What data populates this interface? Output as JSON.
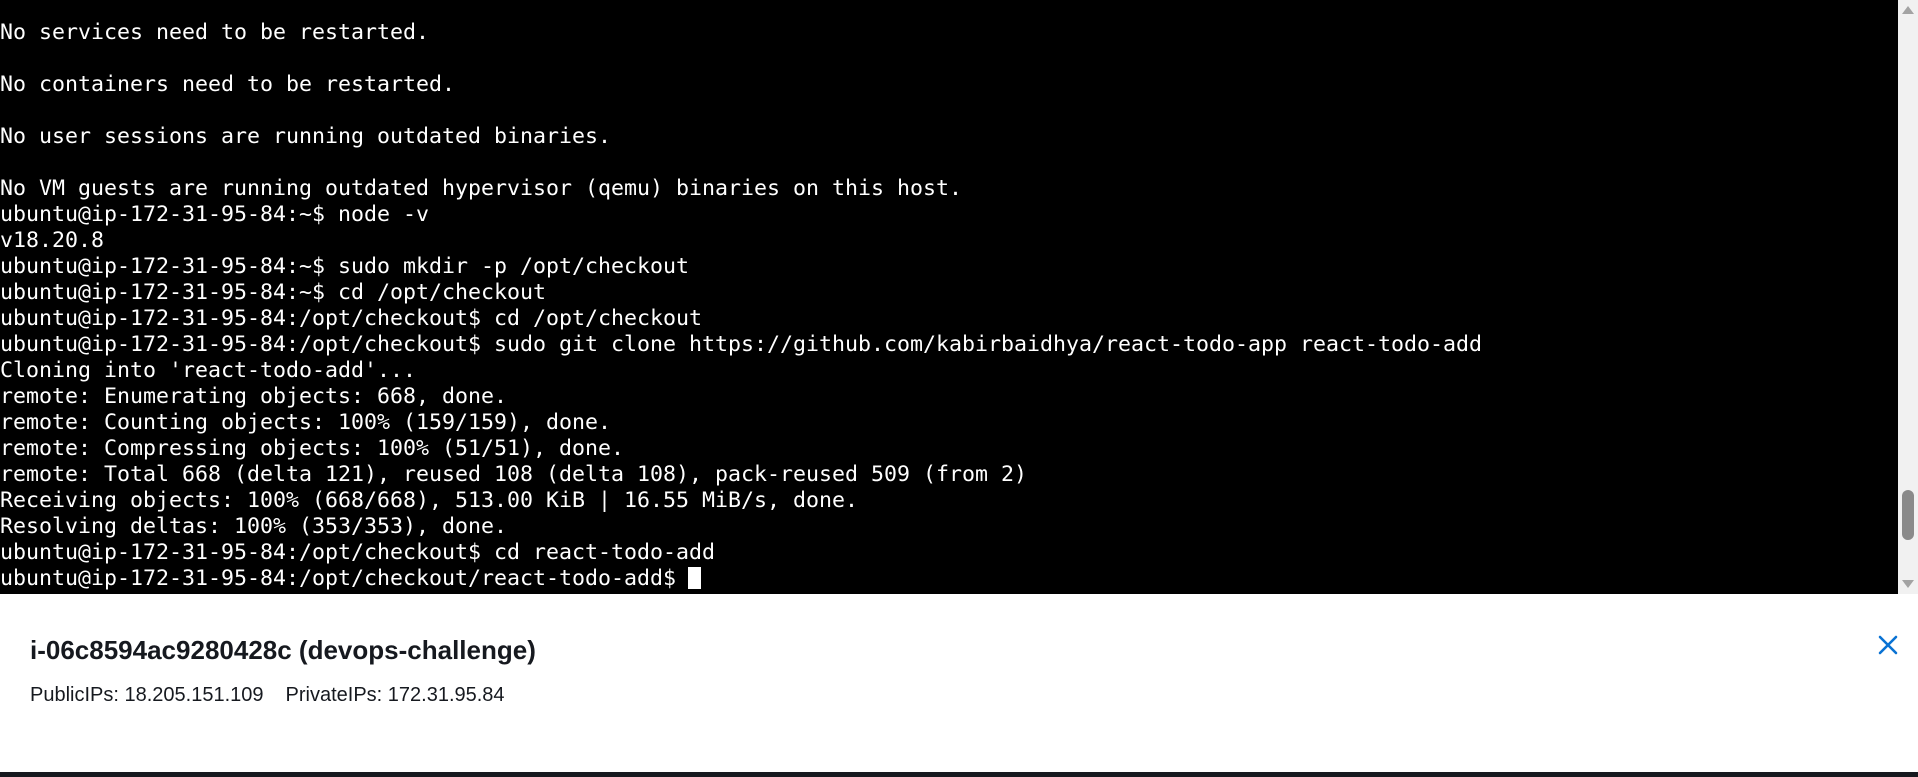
{
  "terminal": {
    "lines": [
      "No services need to be restarted.",
      "",
      "No containers need to be restarted.",
      "",
      "No user sessions are running outdated binaries.",
      "",
      "No VM guests are running outdated hypervisor (qemu) binaries on this host.",
      "ubuntu@ip-172-31-95-84:~$ node -v",
      "v18.20.8",
      "ubuntu@ip-172-31-95-84:~$ sudo mkdir -p /opt/checkout",
      "ubuntu@ip-172-31-95-84:~$ cd /opt/checkout",
      "ubuntu@ip-172-31-95-84:/opt/checkout$ cd /opt/checkout",
      "ubuntu@ip-172-31-95-84:/opt/checkout$ sudo git clone https://github.com/kabirbaidhya/react-todo-app react-todo-add",
      "Cloning into 'react-todo-add'...",
      "remote: Enumerating objects: 668, done.",
      "remote: Counting objects: 100% (159/159), done.",
      "remote: Compressing objects: 100% (51/51), done.",
      "remote: Total 668 (delta 121), reused 108 (delta 108), pack-reused 509 (from 2)",
      "Receiving objects: 100% (668/668), 513.00 KiB | 16.55 MiB/s, done.",
      "Resolving deltas: 100% (353/353), done.",
      "ubuntu@ip-172-31-95-84:/opt/checkout$ cd react-todo-add"
    ],
    "prompt": "ubuntu@ip-172-31-95-84:/opt/checkout/react-todo-add$",
    "scroll_position": 0.93
  },
  "instance": {
    "title": "i-06c8594ac9280428c (devops-challenge)",
    "public_ips": "PublicIPs: 18.205.151.109",
    "private_ips": "PrivateIPs: 172.31.95.84"
  },
  "icons": {
    "close": "close-icon",
    "scroll_up": "chevron-up-icon",
    "scroll_down": "chevron-down-icon"
  },
  "colors": {
    "terminal_bg": "#000000",
    "terminal_fg": "#ffffff",
    "accent": "#0972d3",
    "panel_text": "#16191f"
  }
}
